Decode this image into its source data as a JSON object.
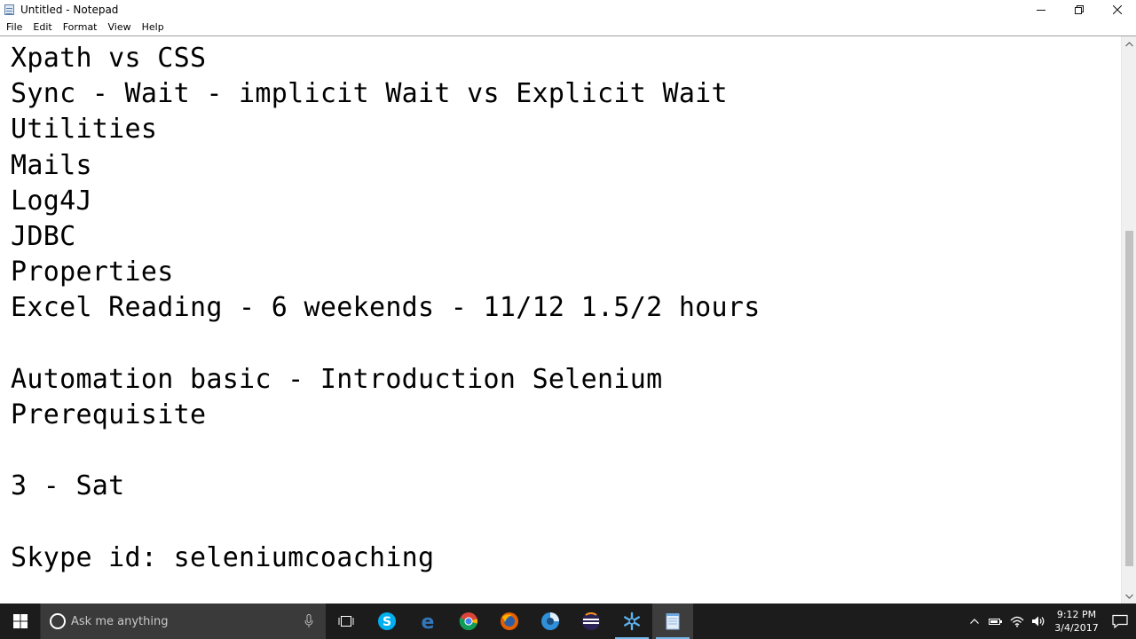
{
  "window": {
    "title": "Untitled - Notepad",
    "controls": {
      "minimize": "minimize",
      "restore": "restore",
      "close": "close"
    }
  },
  "menu": [
    "File",
    "Edit",
    "Format",
    "View",
    "Help"
  ],
  "editor": {
    "lines": [
      "Xpath vs CSS",
      "Sync - Wait - implicit Wait vs Explicit Wait",
      "Utilities",
      "Mails",
      "Log4J",
      "JDBC",
      "Properties",
      "Excel Reading - 6 weekends - 11/12 1.5/2 hours",
      "",
      "Automation basic - Introduction Selenium",
      "Prerequisite",
      "",
      "3 - Sat",
      "",
      "Skype id: seleniumcoaching"
    ]
  },
  "taskbar": {
    "search_placeholder": "Ask me anything",
    "pinned": [
      "skype-icon",
      "edge-icon",
      "chrome-icon",
      "firefox-icon",
      "media-icon",
      "eclipse-icon",
      "snowflake-app-icon",
      "notepad-icon"
    ],
    "clock": {
      "time": "9:12 PM",
      "date": "3/4/2017"
    },
    "accent": "#76b9ed",
    "background": "#1c1c1c"
  }
}
